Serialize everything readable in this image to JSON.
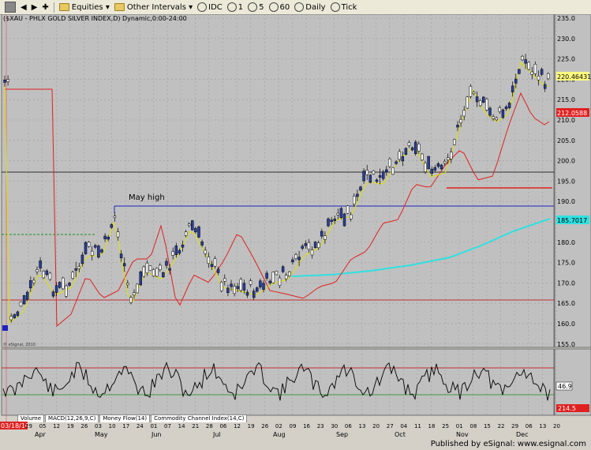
{
  "toolbar": {
    "items": [
      "Equities",
      "Other Intervals",
      "IDC",
      "1",
      "5",
      "60",
      "Daily",
      "Tick"
    ]
  },
  "chart_header": "($XAU - PHLX GOLD SILVER INDEX,D) Dynamic,0:00-24:00",
  "annotation": "May high",
  "watermark": "© eSignal, 2010",
  "price_axis": {
    "ticks": [
      "235.0",
      "230.0",
      "225.0",
      "220.0",
      "215.0",
      "210.0",
      "205.0",
      "200.0",
      "195.0",
      "190.0",
      "185.0",
      "180.0",
      "175.0",
      "170.0",
      "165.0",
      "160.0",
      "155.0"
    ],
    "label_last": "220.46431",
    "label_ma50": "212.0588",
    "label_ma200": "185.7017"
  },
  "indicator_axis": {
    "label_value": "46.9",
    "label_bottom": "214.5"
  },
  "indicator_tabs": [
    "Volume",
    "MACD(12,26,9,C)",
    "Money Flow(14)",
    "Commodity Channel Index(14,C)"
  ],
  "date_axis": {
    "day_labels": [
      "29",
      "05",
      "12",
      "19",
      "26",
      "03",
      "10",
      "17",
      "24",
      "01",
      "07",
      "14",
      "21",
      "28",
      "06",
      "12",
      "19",
      "26",
      "02",
      "09",
      "16",
      "23",
      "30",
      "06",
      "13",
      "20",
      "27",
      "04",
      "11",
      "18",
      "25",
      "01",
      "08",
      "15",
      "22",
      "29",
      "06",
      "13",
      "20"
    ],
    "month_labels": [
      "Apr",
      "May",
      "Jun",
      "Jul",
      "Aug",
      "Sep",
      "Oct",
      "Nov",
      "Dec"
    ],
    "start_date": "03/18/10"
  },
  "footer": "Published by eSignal: www.esignal.com",
  "colors": {
    "candle_up": "#ffffff",
    "candle_down": "#2a3f9e",
    "ma_fast": "#e0e000",
    "ma50": "#e02020",
    "ma200": "#30e0e0",
    "may_high": "#2020c0",
    "resistance": "#e02020"
  }
}
